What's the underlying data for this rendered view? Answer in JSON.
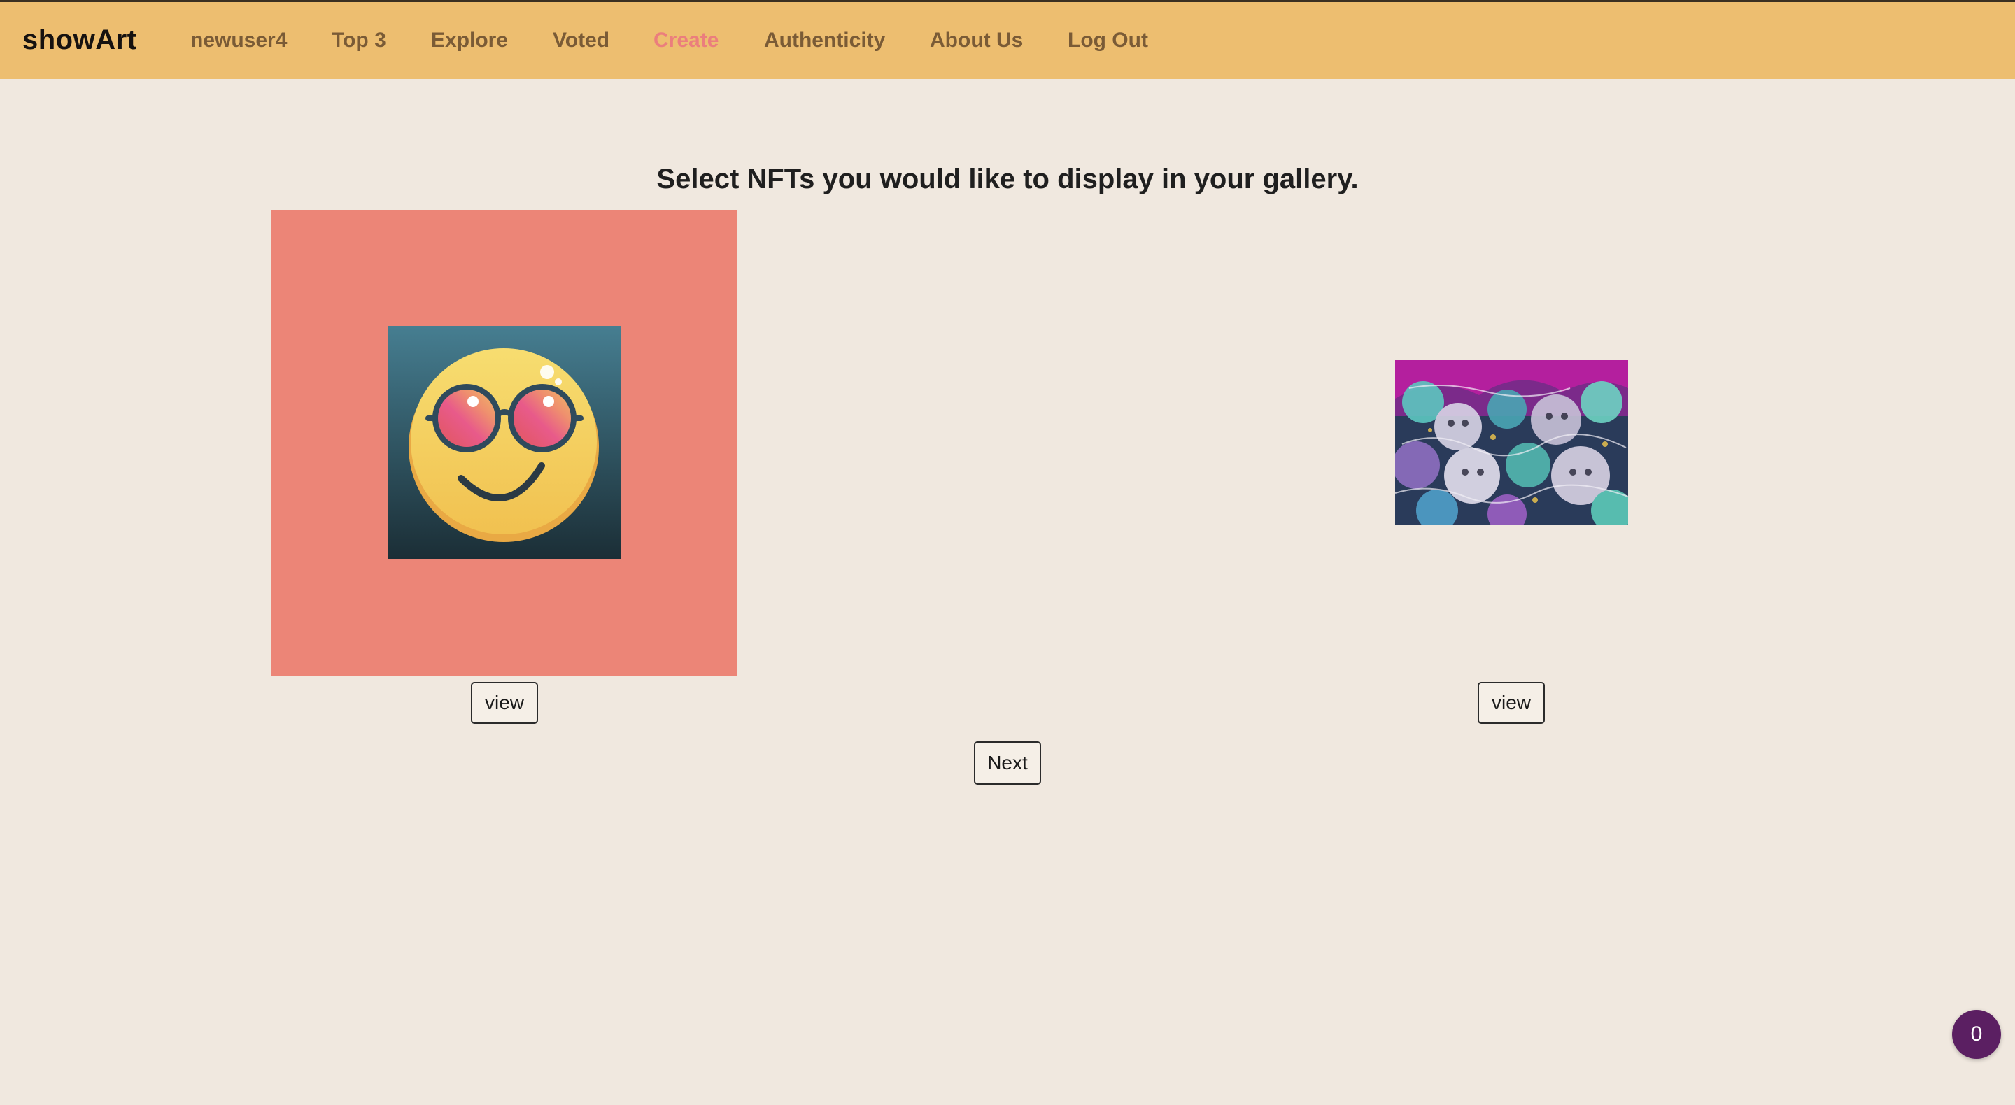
{
  "nav": {
    "brand": "showArt",
    "links": [
      {
        "label": "newuser4",
        "active": false
      },
      {
        "label": "Top 3",
        "active": false
      },
      {
        "label": "Explore",
        "active": false
      },
      {
        "label": "Voted",
        "active": false
      },
      {
        "label": "Create",
        "active": true
      },
      {
        "label": "Authenticity",
        "active": false
      },
      {
        "label": "About Us",
        "active": false
      },
      {
        "label": "Log Out",
        "active": false
      }
    ]
  },
  "main": {
    "heading": "Select NFTs you would like to display in your gallery.",
    "nfts": [
      {
        "image": "smiley-sunglasses-image",
        "selected": true,
        "view_label": "view"
      },
      {
        "image": "psychedelic-wolves-image",
        "selected": false,
        "view_label": "view"
      }
    ],
    "next_label": "Next"
  },
  "badge": {
    "count": "0"
  },
  "colors": {
    "navbar": "#edbe70",
    "background": "#f0e8df",
    "nav_link": "#7a5b36",
    "nav_active": "#eb7e7d",
    "selected_card": "#ec8577",
    "badge": "#5b1f62"
  }
}
